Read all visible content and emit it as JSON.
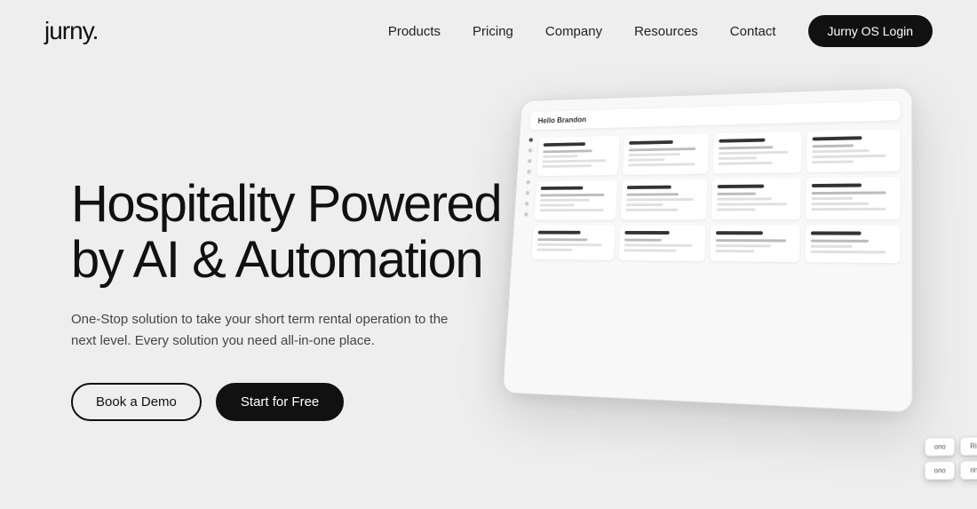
{
  "header": {
    "logo": "jurny.",
    "nav": {
      "products": "Products",
      "pricing": "Pricing",
      "company": "Company",
      "resources": "Resources",
      "contact": "Contact",
      "login": "Jurny OS Login"
    }
  },
  "hero": {
    "title_line1": "Hospitality Powered",
    "title_line2": "by AI & Automation",
    "subtitle": "One-Stop solution to take your short term rental operation to the next level. Every solution you need all-in-one place.",
    "btn_demo": "Book a Demo",
    "btn_start": "Start for Free"
  },
  "device": {
    "dashboard_label": "Hello Brandon",
    "keys": [
      {
        "row": 1,
        "labels": [
          "ono",
          "Ring"
        ]
      },
      {
        "row": 2,
        "labels": [
          "ono"
        ]
      }
    ]
  }
}
